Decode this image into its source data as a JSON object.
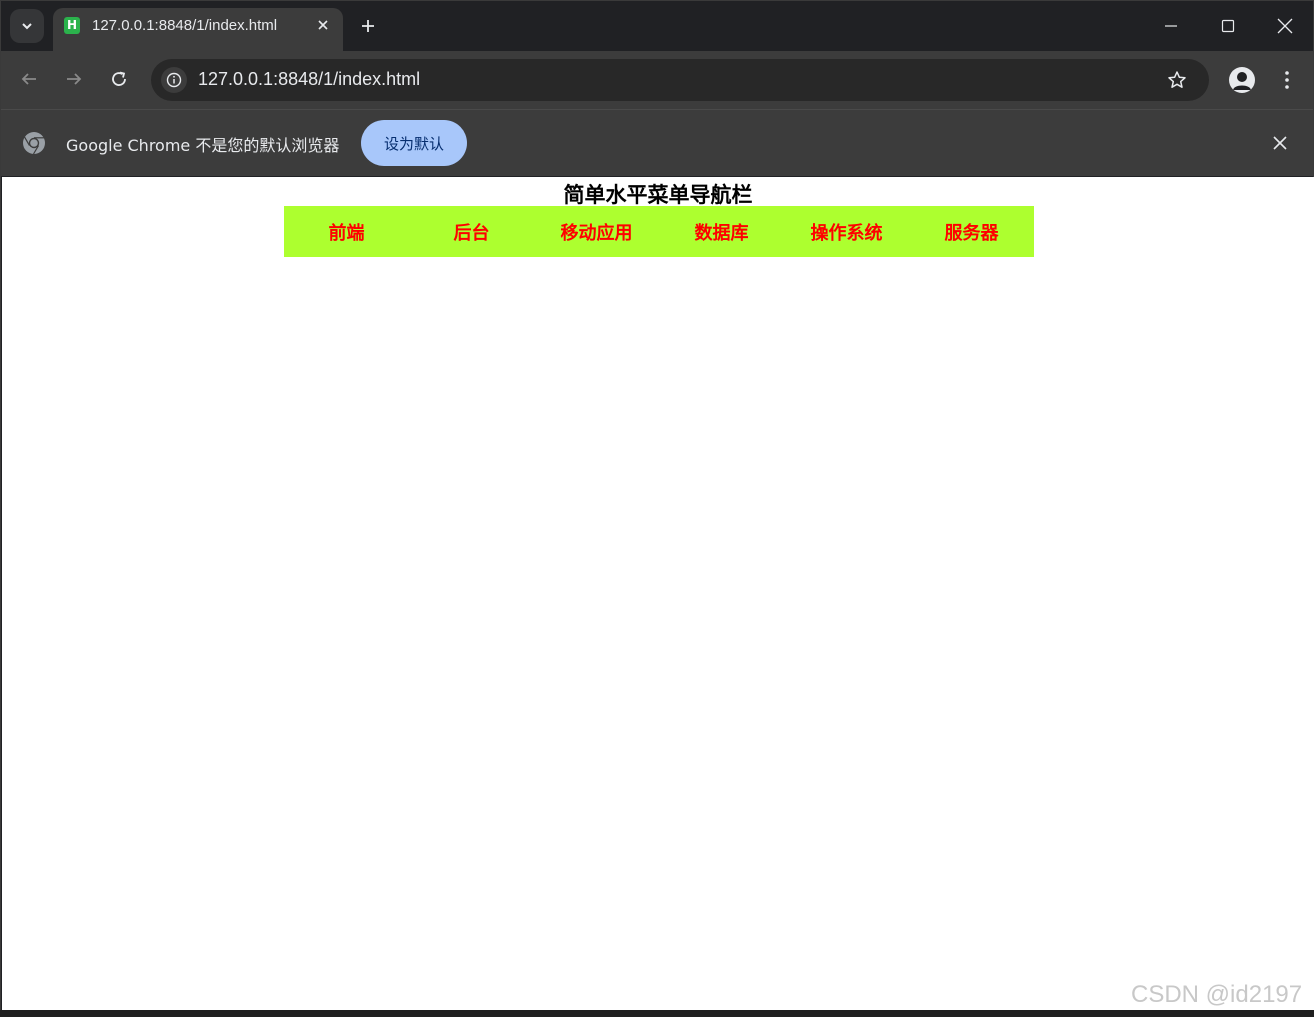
{
  "browser": {
    "tab_title": "127.0.0.1:8848/1/index.html",
    "favicon_letter": "H",
    "url": "127.0.0.1:8848/1/index.html"
  },
  "infobar": {
    "message": "Google Chrome 不是您的默认浏览器",
    "button_label": "设为默认"
  },
  "page": {
    "heading": "简单水平菜单导航栏",
    "menu_items": [
      "前端",
      "后台",
      "移动应用",
      "数据库",
      "操作系统",
      "服务器"
    ],
    "menu_background": "#adff2f",
    "menu_text_color": "#ff0000"
  },
  "watermark": "CSDN @id2197"
}
